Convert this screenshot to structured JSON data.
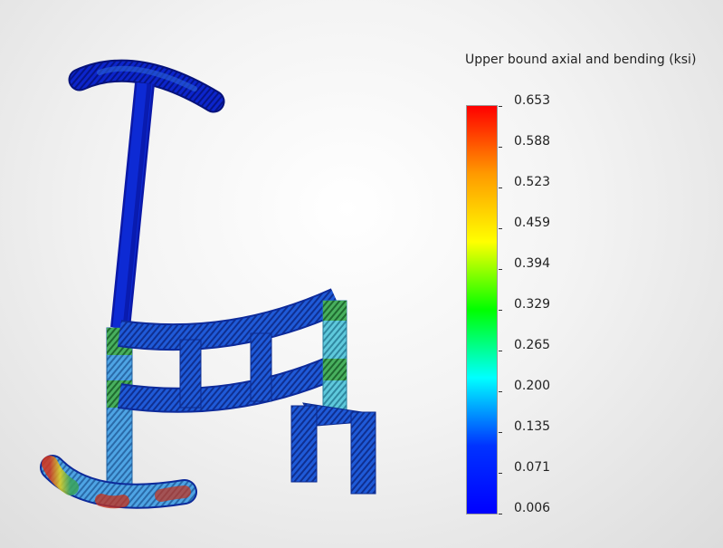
{
  "legend": {
    "title": "Upper bound axial and bending (ksi)",
    "colors": [
      "#ff0000",
      "#ff9a00",
      "#ffff00",
      "#00ff00",
      "#00ffff",
      "#0033ff",
      "#0000ff"
    ],
    "ticks": [
      "0.653",
      "0.588",
      "0.523",
      "0.459",
      "0.394",
      "0.329",
      "0.265",
      "0.200",
      "0.135",
      "0.071",
      "0.006"
    ]
  },
  "model": {
    "colors": {
      "dark_blue": "#0b22c8",
      "mid_blue": "#1a55d8",
      "light_blue": "#3c9be0",
      "cyan": "#4fc3d6",
      "green": "#3ca25a",
      "red": "#c83018"
    }
  }
}
